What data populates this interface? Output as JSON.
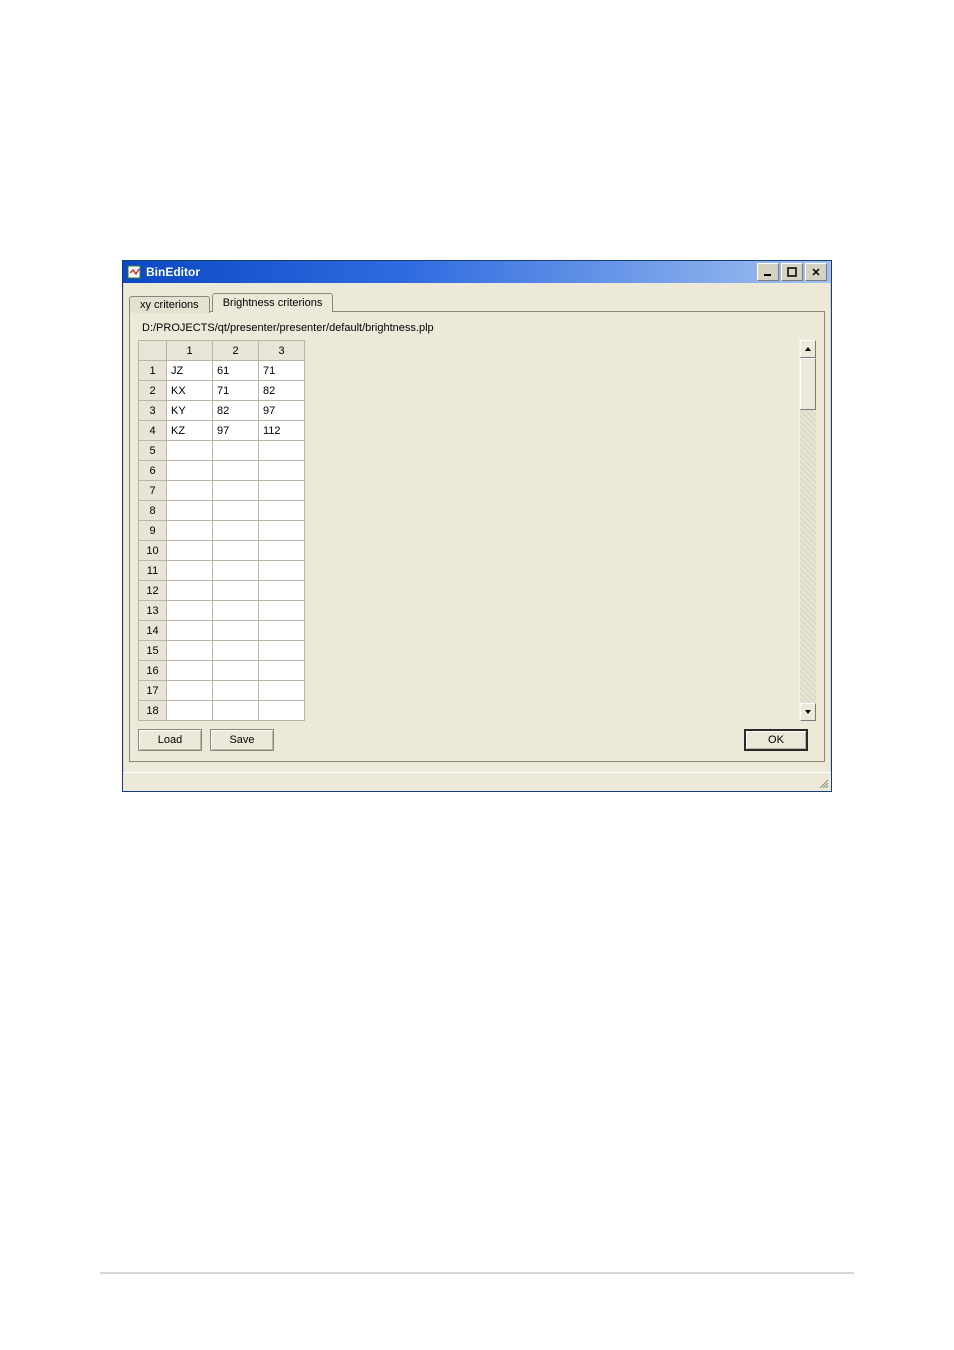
{
  "window": {
    "title": "BinEditor"
  },
  "tabs": {
    "xy": "xy criterions",
    "brightness": "Brightness criterions",
    "active": "brightness"
  },
  "path": "D:/PROJECTS/qt/presenter/presenter/default/brightness.plp",
  "grid": {
    "columns": [
      "1",
      "2",
      "3"
    ],
    "row_count": 18,
    "rows": [
      {
        "n": "1",
        "c1": "JZ",
        "c2": "61",
        "c3": "71"
      },
      {
        "n": "2",
        "c1": "KX",
        "c2": "71",
        "c3": "82"
      },
      {
        "n": "3",
        "c1": "KY",
        "c2": "82",
        "c3": "97"
      },
      {
        "n": "4",
        "c1": "KZ",
        "c2": "97",
        "c3": "112"
      },
      {
        "n": "5",
        "c1": "",
        "c2": "",
        "c3": ""
      },
      {
        "n": "6",
        "c1": "",
        "c2": "",
        "c3": ""
      },
      {
        "n": "7",
        "c1": "",
        "c2": "",
        "c3": ""
      },
      {
        "n": "8",
        "c1": "",
        "c2": "",
        "c3": ""
      },
      {
        "n": "9",
        "c1": "",
        "c2": "",
        "c3": ""
      },
      {
        "n": "10",
        "c1": "",
        "c2": "",
        "c3": ""
      },
      {
        "n": "11",
        "c1": "",
        "c2": "",
        "c3": ""
      },
      {
        "n": "12",
        "c1": "",
        "c2": "",
        "c3": ""
      },
      {
        "n": "13",
        "c1": "",
        "c2": "",
        "c3": ""
      },
      {
        "n": "14",
        "c1": "",
        "c2": "",
        "c3": ""
      },
      {
        "n": "15",
        "c1": "",
        "c2": "",
        "c3": ""
      },
      {
        "n": "16",
        "c1": "",
        "c2": "",
        "c3": ""
      },
      {
        "n": "17",
        "c1": "",
        "c2": "",
        "c3": ""
      },
      {
        "n": "18",
        "c1": "",
        "c2": "",
        "c3": ""
      }
    ]
  },
  "buttons": {
    "load": "Load",
    "save": "Save",
    "ok": "OK"
  }
}
